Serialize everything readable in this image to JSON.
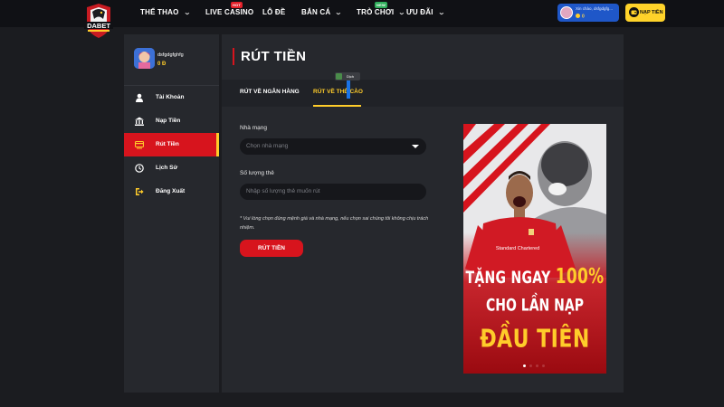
{
  "brand": {
    "logo_text": "DABET",
    "accent": "#d7141d",
    "highlight": "#ffcc2a"
  },
  "nav": {
    "items": [
      {
        "label": "THỂ THAO",
        "dropdown": true
      },
      {
        "label": "LIVE CASINO",
        "dropdown": false,
        "badge": "HOT"
      },
      {
        "label": "LÔ ĐỀ",
        "dropdown": false
      },
      {
        "label": "BẮN CÁ",
        "dropdown": true
      },
      {
        "label": "TRÒ CHƠI",
        "dropdown": true,
        "badge": "NEW"
      },
      {
        "label": "ƯU ĐÃI",
        "dropdown": true
      }
    ],
    "user_greeting": "Xin chào, dsfgdgfg...",
    "user_balance": "0",
    "deposit_label": "NẠP TIỀN"
  },
  "sidebar": {
    "username": "dsfgdgfghfg",
    "balance": "0 Đ",
    "items": [
      {
        "label": "Tài Khoản",
        "icon": "user-icon"
      },
      {
        "label": "Nạp Tiền",
        "icon": "bank-icon"
      },
      {
        "label": "Rút Tiền",
        "icon": "withdraw-icon",
        "active": true
      },
      {
        "label": "Lịch Sử",
        "icon": "history-icon"
      },
      {
        "label": "Đăng Xuất",
        "icon": "logout-icon"
      }
    ]
  },
  "page": {
    "title": "RÚT TIỀN",
    "tabs": [
      {
        "label": "RÚT VỀ NGÂN HÀNG"
      },
      {
        "label": "RÚT VỀ THẺ CÀO",
        "active": true
      }
    ],
    "translate_label": "Dịch"
  },
  "form": {
    "network_label": "Nhà mạng",
    "network_placeholder": "Chọn nhà mạng",
    "quantity_label": "Số lượng thẻ",
    "quantity_placeholder": "Nhập số lượng thẻ muốn rút",
    "note": "* Vui lòng chọn đúng mệnh giá và nhà mạng, nếu chọn sai chúng tôi không chịu trách nhiệm.",
    "submit_label": "RÚT TIỀN"
  },
  "banner": {
    "line1_prefix": "TẶNG NGAY ",
    "line1_highlight": "100%",
    "line2": "CHO LẦN NẠP",
    "line3": "ĐẦU TIÊN",
    "shirt_text": "Standard Chartered",
    "slide_count": 4,
    "active_slide": 1
  }
}
